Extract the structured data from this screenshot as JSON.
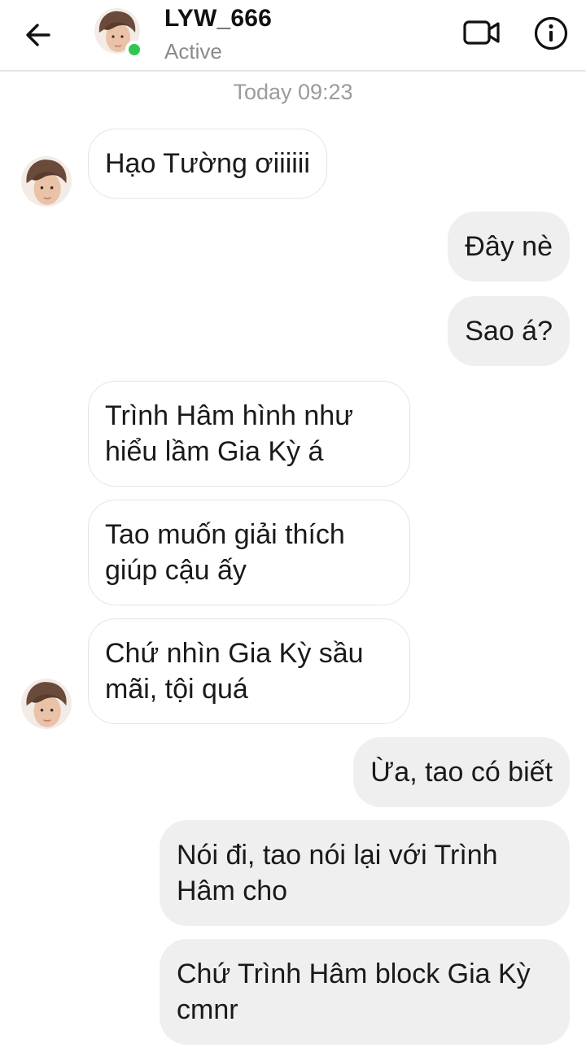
{
  "header": {
    "contact_name": "LYW_666",
    "status": "Active",
    "icons": {
      "back": "arrow-left-icon",
      "video": "video-call-icon",
      "info": "info-icon"
    },
    "online_color": "#31c552"
  },
  "chat": {
    "timestamp": "Today 09:23",
    "messages": [
      {
        "direction": "incoming",
        "text": "Hạo Tường ơiiiiii"
      },
      {
        "direction": "outgoing",
        "text": "Đây nè"
      },
      {
        "direction": "outgoing",
        "text": "Sao á?"
      },
      {
        "direction": "incoming",
        "lines": [
          "Trình Hâm hình như",
          "hiểu lầm Gia Kỳ á"
        ]
      },
      {
        "direction": "incoming",
        "lines": [
          "Tao muốn giải thích",
          "giúp cậu ấy"
        ]
      },
      {
        "direction": "incoming",
        "lines": [
          "Chứ nhìn Gia Kỳ sầu",
          "mãi, tội quá"
        ]
      },
      {
        "direction": "outgoing",
        "text": "Ừa, tao có biết"
      },
      {
        "direction": "outgoing",
        "lines": [
          "Nói đi, tao nói lại với Trình",
          "Hâm cho"
        ]
      },
      {
        "direction": "outgoing",
        "lines": [
          "Chứ Trình Hâm block Gia Kỳ",
          "cmnr"
        ]
      }
    ]
  }
}
